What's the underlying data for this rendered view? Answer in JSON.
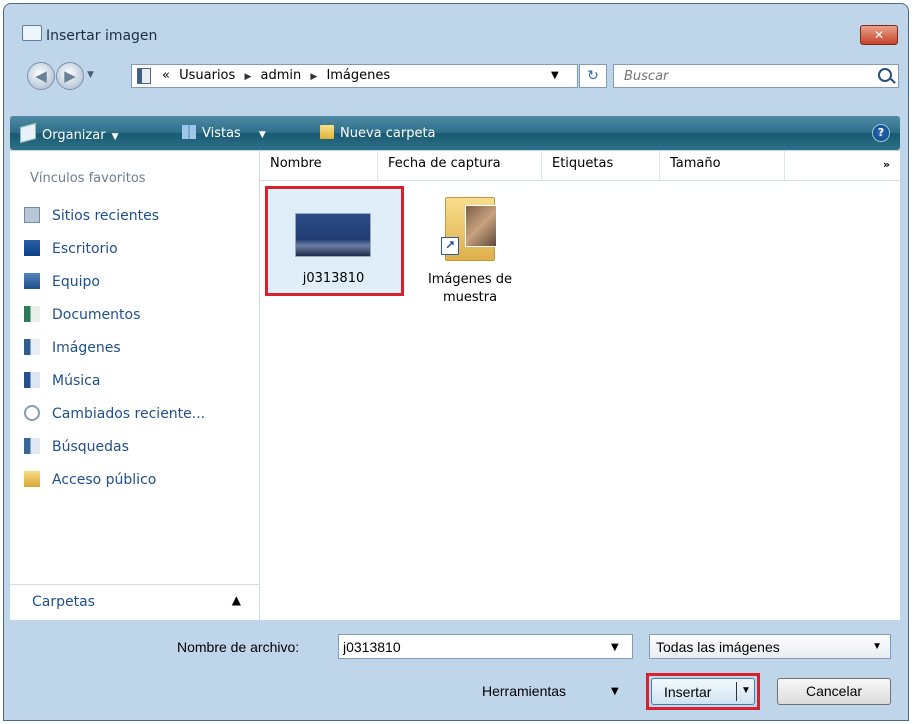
{
  "window": {
    "title": "Insertar imagen",
    "close_glyph": "✕"
  },
  "address": {
    "back_glyph": "◀",
    "forward_glyph": "▶",
    "chevron": "«",
    "crumbs": [
      "Usuarios",
      "admin",
      "Imágenes"
    ],
    "separator": "▶",
    "refresh_glyph": "↻"
  },
  "search": {
    "placeholder": "Buscar"
  },
  "toolbar": {
    "organize_label": "Organizar",
    "views_label": "Vistas",
    "new_folder_label": "Nueva carpeta",
    "help_glyph": "?"
  },
  "nav_pane": {
    "heading": "Vínculos favoritos",
    "items": [
      {
        "label": "Sitios recientes",
        "icon": "recent-places-icon"
      },
      {
        "label": "Escritorio",
        "icon": "desktop-icon"
      },
      {
        "label": "Equipo",
        "icon": "computer-icon"
      },
      {
        "label": "Documentos",
        "icon": "documents-icon"
      },
      {
        "label": "Imágenes",
        "icon": "pictures-icon"
      },
      {
        "label": "Música",
        "icon": "music-icon"
      },
      {
        "label": "Cambiados reciente...",
        "icon": "recently-changed-icon"
      },
      {
        "label": "Búsquedas",
        "icon": "searches-icon"
      },
      {
        "label": "Acceso público",
        "icon": "public-icon"
      }
    ],
    "folders_label": "Carpetas",
    "folders_caret": "▲"
  },
  "columns": {
    "headers": [
      "Nombre",
      "Fecha de captura",
      "Etiquetas",
      "Tamaño"
    ],
    "more": "»"
  },
  "files": [
    {
      "name": "j0313810",
      "type": "image",
      "selected": true
    },
    {
      "name": "Imágenes de muestra",
      "type": "folder-shortcut",
      "selected": false
    }
  ],
  "footer": {
    "filename_label": "Nombre de archivo:",
    "filename_value": "j0313810",
    "filetype_value": "Todas las imágenes",
    "tools_label": "Herramientas",
    "insert_label": "Insertar",
    "cancel_label": "Cancelar",
    "dropdown_glyph": "▼"
  },
  "colors": {
    "toolbar": "#2f6f89",
    "link": "#1f4f8c",
    "highlight": "#d9212e",
    "selection": "#e0eefa"
  }
}
